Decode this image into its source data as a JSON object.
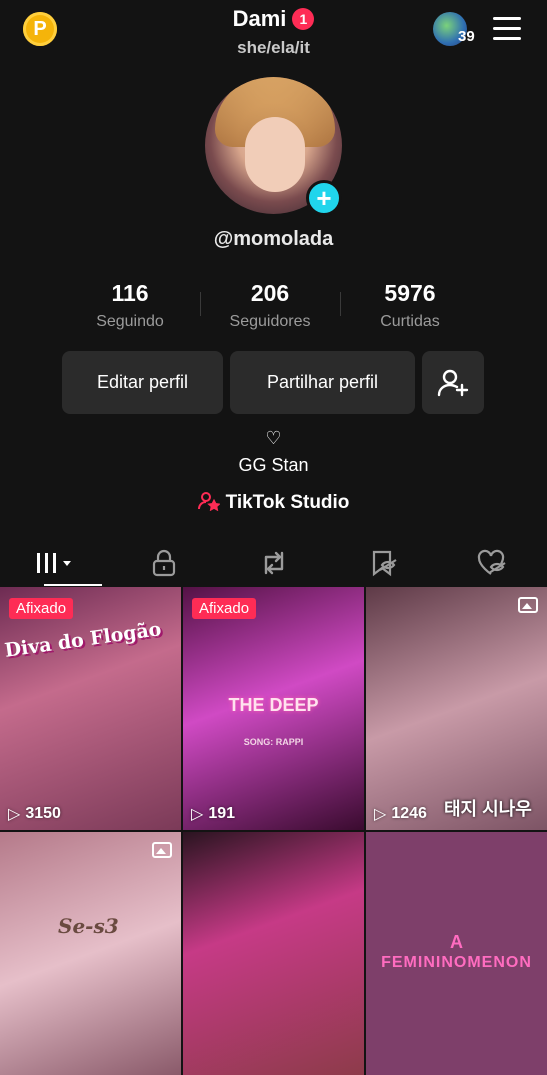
{
  "header": {
    "coin_letter": "P",
    "username": "Dami",
    "notification_count": "1",
    "pronouns": "she/ela/it",
    "friends_count": "39"
  },
  "profile": {
    "handle": "@momolada",
    "stats": [
      {
        "value": "116",
        "label": "Seguindo"
      },
      {
        "value": "206",
        "label": "Seguidores"
      },
      {
        "value": "5976",
        "label": "Curtidas"
      }
    ],
    "buttons": {
      "edit": "Editar perfil",
      "share": "Partilhar perfil"
    },
    "heart": "♡",
    "bio": "GG Stan",
    "studio": "TikTok Studio"
  },
  "tabs": [
    "videos-grid",
    "private",
    "reposts",
    "favorites",
    "liked"
  ],
  "videos": [
    {
      "pinned_label": "Afixado",
      "views": "3150",
      "caption": "Diva do Flogão"
    },
    {
      "pinned_label": "Afixado",
      "views": "191",
      "caption": "THE DEEP",
      "subcaption": "SONG: RAPPI"
    },
    {
      "views": "1246",
      "caption": "태지 시나우"
    },
    {
      "caption": "Se-s3"
    },
    {},
    {
      "caption_line1": "A",
      "caption_line2": "FEMININOMENON"
    }
  ],
  "colors": {
    "accent_red": "#fe2c55",
    "accent_cyan": "#20d5ec",
    "coin": "#f5b40a",
    "background": "#131313"
  }
}
